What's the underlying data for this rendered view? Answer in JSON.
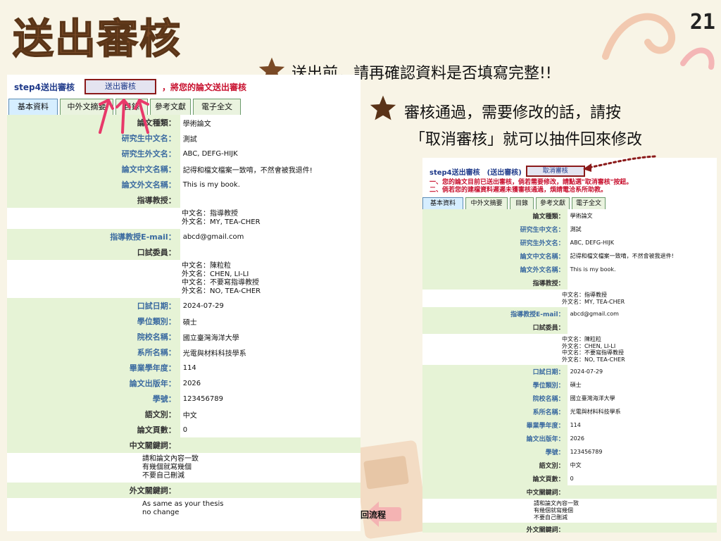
{
  "slide": {
    "title": "送出審核",
    "page_number": "21",
    "note1": "送出前，請再確認資料是否填寫完整!!",
    "note2_line1": "審核通過，需要修改的話，請按",
    "note2_line2": "「取消審核」就可以抽件回來修改",
    "back_label": "回流程",
    "colors": {
      "title": "#7a4a26",
      "star": "#7a4a26",
      "arrow": "#e8396a"
    }
  },
  "left": {
    "step_title": "step4送出審核",
    "submit_button": "送出審核",
    "instruction": "，將您的論文送出審核",
    "tabs": [
      "基本資料",
      "中外文摘要",
      "目錄",
      "參考文獻",
      "電子全文"
    ],
    "fields": {
      "thesis_type": {
        "label": "論文種類：",
        "value": "學術論文"
      },
      "name_zh": {
        "label": "研究生中文名：",
        "value": "測試"
      },
      "name_en": {
        "label": "研究生外文名：",
        "value": "ABC, DEFG-HIJK"
      },
      "title_zh": {
        "label": "論文中文名稱：",
        "value": "記得和檔文檔案一致唷，不然會被我退件!"
      },
      "title_en": {
        "label": "論文外文名稱：",
        "value": "This is my book."
      },
      "advisor": {
        "label": "指導教授："
      },
      "advisor_zh": {
        "label": "中文名：",
        "value": "指導教授"
      },
      "advisor_en": {
        "label": "外文名：",
        "value": "MY, TEA-CHER"
      },
      "advisor_email": {
        "label": "指導教授E-mail：",
        "value": "abcd@gmail.com"
      },
      "committee": {
        "label": "口試委員："
      },
      "c1_zh": {
        "label": "中文名：",
        "value": "陳粒粒"
      },
      "c1_en": {
        "label": "外文名：",
        "value": "CHEN, LI-LI"
      },
      "c2_zh": {
        "label": "中文名：",
        "value": "不要寫指導教授"
      },
      "c2_en": {
        "label": "外文名：",
        "value": "NO, TEA-CHER"
      },
      "oral_date": {
        "label": "口試日期：",
        "value": "2024-07-29"
      },
      "degree": {
        "label": "學位類別：",
        "value": "碩士"
      },
      "school": {
        "label": "院校名稱：",
        "value": "國立臺灣海洋大學"
      },
      "dept": {
        "label": "系所名稱：",
        "value": "光電與材料科技學系"
      },
      "grad_year": {
        "label": "畢業學年度：",
        "value": "114"
      },
      "pub_year": {
        "label": "論文出版年：",
        "value": "2026"
      },
      "student_id": {
        "label": "學號：",
        "value": "123456789"
      },
      "language": {
        "label": "語文別：",
        "value": "中文"
      },
      "pages": {
        "label": "論文頁數：",
        "value": "0"
      },
      "kw_zh": {
        "label": "中文關鍵詞：",
        "lines": [
          "請和論文內容一致",
          "有幾個就寫幾個",
          "不要自己刪減"
        ]
      },
      "kw_en": {
        "label": "外文關鍵詞：",
        "lines": [
          "As same as your thesis",
          "no change"
        ]
      }
    }
  },
  "right": {
    "step_title": "step4送出審核",
    "status": "(送出審核)",
    "cancel_button": "取消審核",
    "warn1": "一、您的論文目前已送出審核，倘若需要修改，請點選\"取消審核\"按鈕。",
    "warn2": "二、倘若您的建檔資料遲遲未獲審核通過，煩請電洽系所助教。",
    "tabs": [
      "基本資料",
      "中外文摘要",
      "目錄",
      "參考文獻",
      "電子全文"
    ],
    "fields": {
      "thesis_type": {
        "label": "論文種類：",
        "value": "學術論文"
      },
      "name_zh": {
        "label": "研究生中文名：",
        "value": "測試"
      },
      "name_en": {
        "label": "研究生外文名：",
        "value": "ABC, DEFG-HIJK"
      },
      "title_zh": {
        "label": "論文中文名稱：",
        "value": "記得和檔文檔案一致唷，不然會被我退件!"
      },
      "title_en": {
        "label": "論文外文名稱：",
        "value": "This is my book."
      },
      "advisor": {
        "label": "指導教授："
      },
      "advisor_zh": {
        "label": "中文名：",
        "value": "指導教授"
      },
      "advisor_en": {
        "label": "外文名：",
        "value": "MY, TEA-CHER"
      },
      "advisor_email": {
        "label": "指導教授E-mail：",
        "value": "abcd@gmail.com"
      },
      "committee": {
        "label": "口試委員："
      },
      "c1_zh": {
        "label": "中文名：",
        "value": "陳粒粒"
      },
      "c1_en": {
        "label": "外文名：",
        "value": "CHEN, LI-LI"
      },
      "c2_zh": {
        "label": "中文名：",
        "value": "不要寫指導教授"
      },
      "c2_en": {
        "label": "外文名：",
        "value": "NO, TEA-CHER"
      },
      "oral_date": {
        "label": "口試日期：",
        "value": "2024-07-29"
      },
      "degree": {
        "label": "學位類別：",
        "value": "碩士"
      },
      "school": {
        "label": "院校名稱：",
        "value": "國立臺灣海洋大學"
      },
      "dept": {
        "label": "系所名稱：",
        "value": "光電與材料科技學系"
      },
      "grad_year": {
        "label": "畢業學年度：",
        "value": "114"
      },
      "pub_year": {
        "label": "論文出版年：",
        "value": "2026"
      },
      "student_id": {
        "label": "學號：",
        "value": "123456789"
      },
      "language": {
        "label": "語文別：",
        "value": "中文"
      },
      "pages": {
        "label": "論文頁數：",
        "value": "0"
      },
      "kw_zh": {
        "label": "中文關鍵詞：",
        "lines": [
          "請和論文內容一致",
          "有幾個就寫幾個",
          "不要自己刪減"
        ]
      },
      "kw_en": {
        "label": "外文關鍵詞："
      }
    }
  }
}
